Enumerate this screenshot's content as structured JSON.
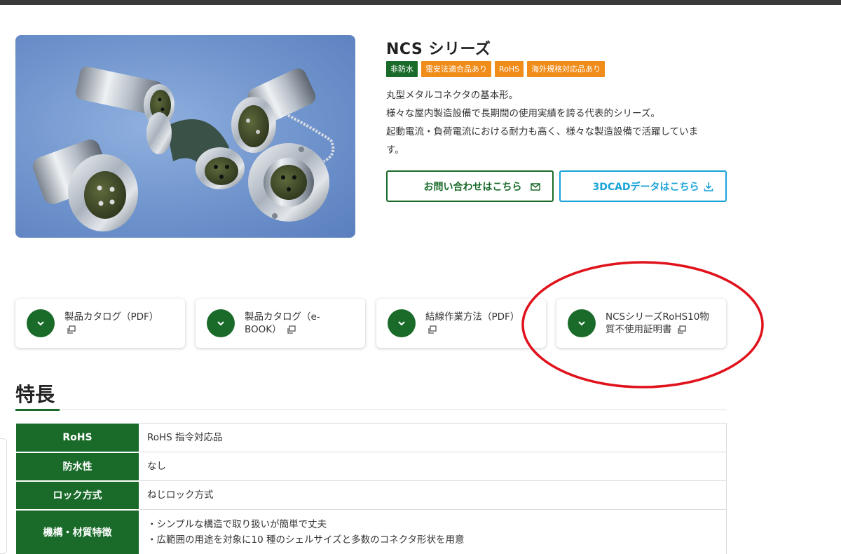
{
  "product": {
    "title": "NCS シリーズ",
    "badges": [
      "非防水",
      "電安法適合品あり",
      "RoHS",
      "海外規格対応品あり"
    ],
    "description": [
      "丸型メタルコネクタの基本形。",
      "様々な屋内製造設備で長期間の使用実績を誇る代表的シリーズ。",
      "起動電流・負荷電流における耐力も高く、様々な製造設備で活躍していま",
      "す。"
    ],
    "image_icon": "connector-product-photo"
  },
  "buttons": {
    "contact_label": "お問い合わせはこちら",
    "contact_icon": "mail-icon",
    "cad_label": "3DCADデータはこちら",
    "cad_icon": "download-icon"
  },
  "downloads": [
    {
      "line1": "製品カタログ（PDF）",
      "line2": ""
    },
    {
      "line1": "製品カタログ（e-",
      "line2": "BOOK）"
    },
    {
      "line1": "結線作業方法（PDF）",
      "line2": ""
    },
    {
      "line1": "NCSシリーズRoHS10物",
      "line2": "質不使用証明書"
    }
  ],
  "features": {
    "title": "特長",
    "rows": [
      {
        "label": "RoHS",
        "value": "RoHS 指令対応品"
      },
      {
        "label": "防水性",
        "value": "なし"
      },
      {
        "label": "ロック方式",
        "value": "ねじロック方式"
      },
      {
        "label": "機構・材質特徴",
        "value": "・シンプルな構造で取り扱いが簡単で丈夫",
        "value2": "・広範囲の用途を対象に10 種のシェルサイズと多数のコネクタ形状を用意"
      }
    ]
  },
  "colors": {
    "brand_green": "#1a6b2a",
    "badge_orange": "#f08c1a",
    "cad_blue": "#1aa3d9",
    "annotation_red": "#e0121b"
  }
}
